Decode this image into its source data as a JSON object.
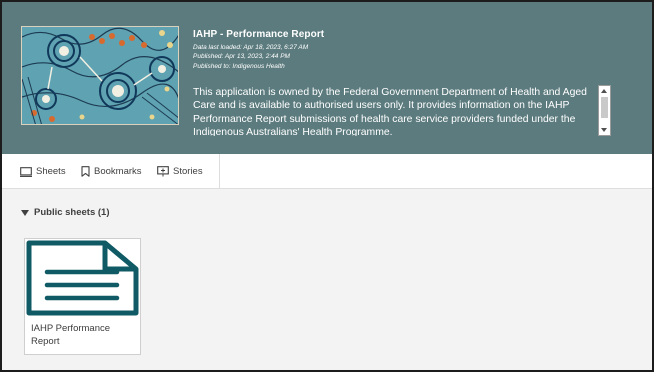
{
  "app": {
    "title": "IAHP - Performance Report",
    "data_last_loaded": "Data last loaded: Apr 18, 2023, 6:27 AM",
    "published": "Published: Apr 13, 2023, 2:44 PM",
    "published_to": "Published to: Indigenous Health",
    "description": "This application is owned by the Federal Government Department of Health and Aged Care and is available to authorised users only. It provides information on the IAHP Performance Report submissions of health care service providers funded under the Indigenous Australians' Health Programme."
  },
  "tabs": [
    {
      "label": "Sheets",
      "icon": "sheets-icon"
    },
    {
      "label": "Bookmarks",
      "icon": "bookmark-icon"
    },
    {
      "label": "Stories",
      "icon": "stories-icon"
    }
  ],
  "section": {
    "title": "Public sheets (1)"
  },
  "sheets": [
    {
      "label": "IAHP Performance Report",
      "icon": "sheet-document-icon"
    }
  ],
  "colors": {
    "header_bg": "#5c7b7e",
    "sheet_icon": "#0f5a64",
    "background": "#f3f3f3"
  }
}
